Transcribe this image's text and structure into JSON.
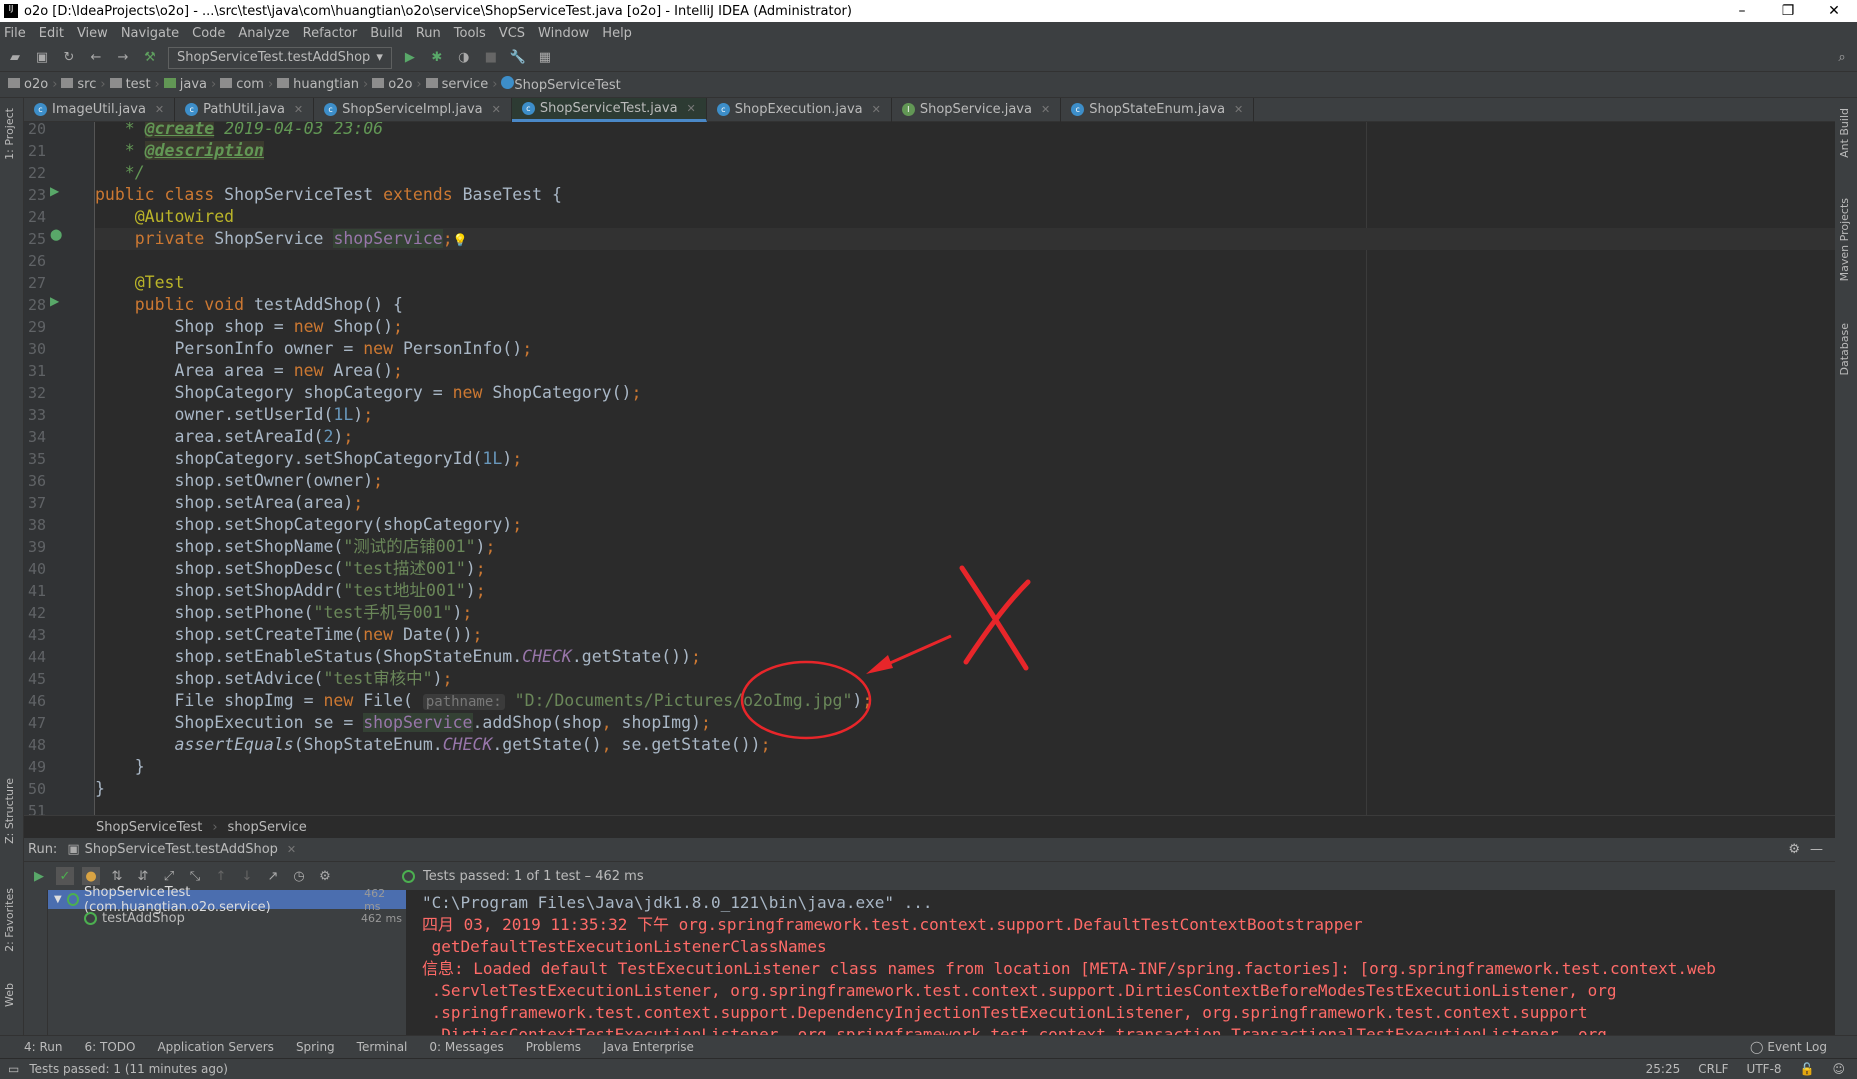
{
  "window": {
    "title": "o2o [D:\\IdeaProjects\\o2o] - ...\\src\\test\\java\\com\\huangtian\\o2o\\service\\ShopServiceTest.java [o2o] - IntelliJ IDEA (Administrator)"
  },
  "menu": [
    "File",
    "Edit",
    "View",
    "Navigate",
    "Code",
    "Analyze",
    "Refactor",
    "Build",
    "Run",
    "Tools",
    "VCS",
    "Window",
    "Help"
  ],
  "toolbar": {
    "run_config": "ShopServiceTest.testAddShop"
  },
  "breadcrumbs": [
    "o2o",
    "src",
    "test",
    "java",
    "com",
    "huangtian",
    "o2o",
    "service",
    "ShopServiceTest"
  ],
  "tabs": [
    {
      "label": "ImageUtil.java"
    },
    {
      "label": "PathUtil.java"
    },
    {
      "label": "ShopServiceImpl.java"
    },
    {
      "label": "ShopServiceTest.java",
      "active": true
    },
    {
      "label": "ShopExecution.java"
    },
    {
      "label": "ShopService.java"
    },
    {
      "label": "ShopStateEnum.java"
    }
  ],
  "side_panels": {
    "left": [
      "1: Project",
      "Z: Structure",
      "2: Favorites",
      "Web"
    ],
    "right": [
      "Ant Build",
      "Maven Projects",
      "Database"
    ]
  },
  "editor": {
    "first_line": 20,
    "current_line": 25,
    "lines": [
      [
        [
          "doc",
          "   * "
        ],
        [
          "doctag",
          "@create"
        ],
        [
          "doc",
          " 2019-04-03 23:06"
        ]
      ],
      [
        [
          "doc",
          "   * "
        ],
        [
          "doctag",
          "@description"
        ]
      ],
      [
        [
          "doc",
          "   */"
        ]
      ],
      [
        [
          "kw",
          "public class "
        ],
        [
          "",
          "ShopServiceTest "
        ],
        [
          "kw",
          "extends "
        ],
        [
          "",
          "BaseTest {"
        ]
      ],
      [
        [
          "ann",
          "    @Autowired"
        ]
      ],
      [
        [
          "kw",
          "    private "
        ],
        [
          "",
          "ShopService "
        ],
        [
          "fldbg",
          "shopService"
        ],
        [
          "kw",
          ";"
        ]
      ],
      [
        [
          "",
          ""
        ]
      ],
      [
        [
          "ann",
          "    @Test"
        ]
      ],
      [
        [
          "kw",
          "    public void "
        ],
        [
          "",
          "testAddShop() {"
        ]
      ],
      [
        [
          "",
          "        Shop shop = "
        ],
        [
          "kw",
          "new "
        ],
        [
          "",
          "Shop()"
        ],
        [
          "kw",
          ";"
        ]
      ],
      [
        [
          "",
          "        PersonInfo owner = "
        ],
        [
          "kw",
          "new "
        ],
        [
          "",
          "PersonInfo()"
        ],
        [
          "kw",
          ";"
        ]
      ],
      [
        [
          "",
          "        Area area = "
        ],
        [
          "kw",
          "new "
        ],
        [
          "",
          "Area()"
        ],
        [
          "kw",
          ";"
        ]
      ],
      [
        [
          "",
          "        ShopCategory shopCategory = "
        ],
        [
          "kw",
          "new "
        ],
        [
          "",
          "ShopCategory()"
        ],
        [
          "kw",
          ";"
        ]
      ],
      [
        [
          "",
          "        owner.setUserId("
        ],
        [
          "num",
          "1L"
        ],
        [
          "",
          ")"
        ],
        [
          "kw",
          ";"
        ]
      ],
      [
        [
          "",
          "        area.setAreaId("
        ],
        [
          "num",
          "2"
        ],
        [
          "",
          ")"
        ],
        [
          "kw",
          ";"
        ]
      ],
      [
        [
          "",
          "        shopCategory.setShopCategoryId("
        ],
        [
          "num",
          "1L"
        ],
        [
          "",
          ")"
        ],
        [
          "kw",
          ";"
        ]
      ],
      [
        [
          "",
          "        shop.setOwner(owner)"
        ],
        [
          "kw",
          ";"
        ]
      ],
      [
        [
          "",
          "        shop.setArea(area)"
        ],
        [
          "kw",
          ";"
        ]
      ],
      [
        [
          "",
          "        shop.setShopCategory(shopCategory)"
        ],
        [
          "kw",
          ";"
        ]
      ],
      [
        [
          "",
          "        shop.setShopName("
        ],
        [
          "str",
          "\"测试的店铺001\""
        ],
        [
          "",
          ")"
        ],
        [
          "kw",
          ";"
        ]
      ],
      [
        [
          "",
          "        shop.setShopDesc("
        ],
        [
          "str",
          "\"test描述001\""
        ],
        [
          "",
          ")"
        ],
        [
          "kw",
          ";"
        ]
      ],
      [
        [
          "",
          "        shop.setShopAddr("
        ],
        [
          "str",
          "\"test地址001\""
        ],
        [
          "",
          ")"
        ],
        [
          "kw",
          ";"
        ]
      ],
      [
        [
          "",
          "        shop.setPhone("
        ],
        [
          "str",
          "\"test手机号001\""
        ],
        [
          "",
          ")"
        ],
        [
          "kw",
          ";"
        ]
      ],
      [
        [
          "",
          "        shop.setCreateTime("
        ],
        [
          "kw",
          "new "
        ],
        [
          "",
          "Date())"
        ],
        [
          "kw",
          ";"
        ]
      ],
      [
        [
          "",
          "        shop.setEnableStatus(ShopStateEnum."
        ],
        [
          "ist",
          "CHECK"
        ],
        [
          "",
          ".getState())"
        ],
        [
          "kw",
          ";"
        ]
      ],
      [
        [
          "",
          "        shop.setAdvice("
        ],
        [
          "str",
          "\"test审核中\""
        ],
        [
          "",
          ")"
        ],
        [
          "kw",
          ";"
        ]
      ],
      [
        [
          "",
          "        File shopImg = "
        ],
        [
          "kw",
          "new "
        ],
        [
          "",
          "File( "
        ],
        [
          "hint",
          "pathname:"
        ],
        [
          "str",
          " \"D:/Documents/Pictures/o2oImg.jpg\""
        ],
        [
          "",
          ")"
        ],
        [
          "kw",
          ";"
        ]
      ],
      [
        [
          "",
          "        ShopExecution se = "
        ],
        [
          "fldbg",
          "shopService"
        ],
        [
          "",
          ".addShop(shop"
        ],
        [
          "kw",
          ", "
        ],
        [
          "",
          "shopImg)"
        ],
        [
          "kw",
          ";"
        ]
      ],
      [
        [
          "ital",
          "        assertEquals"
        ],
        [
          "",
          "(ShopStateEnum."
        ],
        [
          "ist",
          "CHECK"
        ],
        [
          "",
          ".getState()"
        ],
        [
          "kw",
          ", "
        ],
        [
          "",
          "se.getState())"
        ],
        [
          "kw",
          ";"
        ]
      ],
      [
        [
          "",
          "    }"
        ]
      ],
      [
        [
          "",
          "}"
        ]
      ],
      [
        [
          "",
          ""
        ]
      ]
    ]
  },
  "editor_breadcrumb": [
    "ShopServiceTest",
    "shopService"
  ],
  "run": {
    "label": "Run:",
    "tab": "ShopServiceTest.testAddShop",
    "status": "Tests passed: 1 of 1 test – 462 ms",
    "tree": [
      {
        "label": "ShopServiceTest (com.huangtian.o2o.service)",
        "time": "462 ms",
        "selected": true
      },
      {
        "label": "testAddShop",
        "time": "462 ms"
      }
    ],
    "console": [
      {
        "cls": "cmd",
        "text": "\"C:\\Program Files\\Java\\jdk1.8.0_121\\bin\\java.exe\" ..."
      },
      {
        "cls": "",
        "text": "四月 03, 2019 11:35:32 下午 org.springframework.test.context.support.DefaultTestContextBootstrapper"
      },
      {
        "cls": "",
        "text": " getDefaultTestExecutionListenerClassNames"
      },
      {
        "cls": "",
        "text": "信息: Loaded default TestExecutionListener class names from location [META-INF/spring.factories]: [org.springframework.test.context.web"
      },
      {
        "cls": "",
        "text": " .ServletTestExecutionListener, org.springframework.test.context.support.DirtiesContextBeforeModesTestExecutionListener, org"
      },
      {
        "cls": "",
        "text": " .springframework.test.context.support.DependencyInjectionTestExecutionListener, org.springframework.test.context.support"
      },
      {
        "cls": "",
        "text": " .DirtiesContextTestExecutionListener, org.springframework.test.context.transaction.TransactionalTestExecutionListener, org"
      }
    ]
  },
  "tool_windows": [
    "4: Run",
    "6: TODO",
    "Application Servers",
    "Spring",
    "Terminal",
    "0: Messages",
    "Problems",
    "Java Enterprise"
  ],
  "event_log": "Event Log",
  "status": {
    "message": "Tests passed: 1 (11 minutes ago)",
    "position": "25:25",
    "line_sep": "CRLF",
    "encoding": "UTF-8"
  },
  "annotation_color": "#e8262a"
}
